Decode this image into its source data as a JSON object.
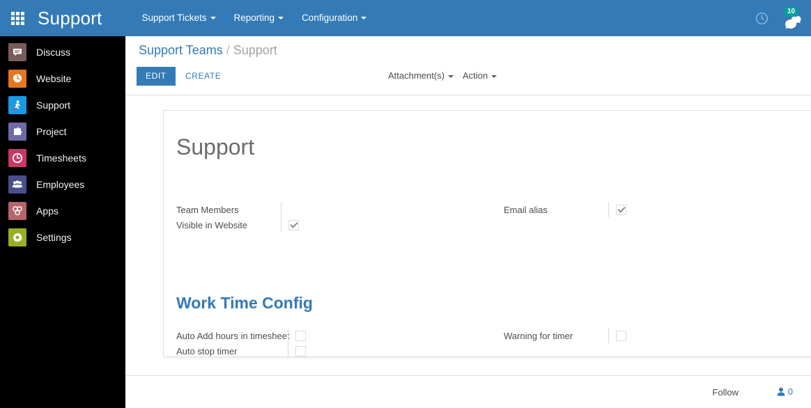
{
  "navbar": {
    "apps_icon": "apps-grid-icon",
    "brand": "Support",
    "menus": [
      {
        "label": "Support Tickets",
        "icon": "caret-down-icon"
      },
      {
        "label": "Reporting",
        "icon": "caret-down-icon"
      },
      {
        "label": "Configuration",
        "icon": "caret-down-icon"
      }
    ],
    "clock_icon": "clock-icon",
    "messaging_icon": "messaging-icon",
    "messaging_count": "10",
    "bg_color": "#337ab7",
    "badge_color": "#00a09d"
  },
  "sidebar": {
    "bg_color": "#000000",
    "items": [
      {
        "label": "Discuss",
        "icon": "discuss-icon",
        "color": "#7a5b5b"
      },
      {
        "label": "Website",
        "icon": "website-icon",
        "color": "#e8761e"
      },
      {
        "label": "Support",
        "icon": "support-icon",
        "color": "#1a9ae3"
      },
      {
        "label": "Project",
        "icon": "project-icon",
        "color": "#6f6aa8"
      },
      {
        "label": "Timesheets",
        "icon": "timesheets-icon",
        "color": "#c9386b"
      },
      {
        "label": "Employees",
        "icon": "employees-icon",
        "color": "#4a4f8c"
      },
      {
        "label": "Apps",
        "icon": "apps-icon",
        "color": "#b5656b"
      },
      {
        "label": "Settings",
        "icon": "settings-icon",
        "color": "#9aad27"
      }
    ]
  },
  "control_panel": {
    "breadcrumb": {
      "parent": "Support Teams",
      "separator": "/",
      "current": "Support"
    },
    "edit_label": "EDIT",
    "create_label": "CREATE",
    "attachments_label": "Attachment(s)",
    "action_label": "Action"
  },
  "form": {
    "title": "Support",
    "groups": [
      {
        "heading": null,
        "left_fields": [
          {
            "label": "Team Members",
            "type": "empty"
          },
          {
            "label": "Visible in Website",
            "type": "checkbox",
            "checked": true
          }
        ],
        "right_fields": [
          {
            "label": "Email alias",
            "type": "checkbox",
            "checked": true
          }
        ]
      },
      {
        "heading": "Work Time Config",
        "left_fields": [
          {
            "label": "Auto Add hours in timesheet",
            "type": "checkbox",
            "checked": false
          },
          {
            "label": "Auto stop timer",
            "type": "checkbox",
            "checked": false
          }
        ],
        "right_fields": [
          {
            "label": "Warning for timer",
            "type": "checkbox",
            "checked": false
          }
        ]
      }
    ],
    "section_heading_color": "#337ab7"
  },
  "chatter": {
    "follow_label": "Follow",
    "followers_icon": "user-icon",
    "followers_count": "0"
  }
}
